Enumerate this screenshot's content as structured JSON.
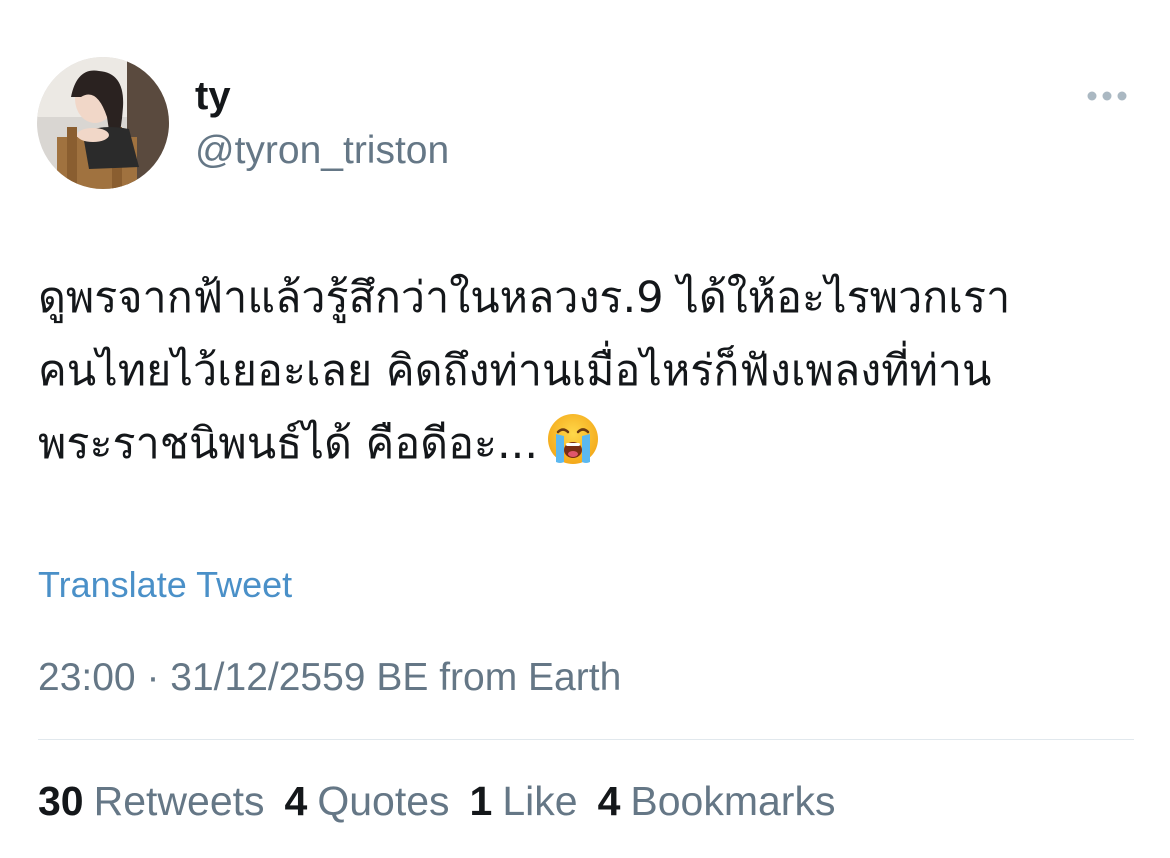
{
  "user": {
    "display_name": "ty",
    "handle": "@tyron_triston"
  },
  "menu": {
    "icon": "more-horizontal-icon"
  },
  "tweet": {
    "text_line1": "ดูพรจากฟ้าแล้วรู้สึกว่าในหลวงร.9 ได้ให้อะไรพวกเรา",
    "text_line2": "คนไทยไว้เยอะเลย คิดถึงท่านเมื่อไหร่ก็ฟังเพลงที่ท่าน",
    "text_line3": "พระราชนิพนธ์ได้ คือดีอะ...",
    "emoji": "loudly-crying-face-icon"
  },
  "translate_label": "Translate Tweet",
  "meta": {
    "time": "23:00",
    "separator": "·",
    "date": "31/12/2559 BE",
    "source": "from Earth"
  },
  "stats": {
    "retweets_count": "30",
    "retweets_label": "Retweets",
    "quotes_count": "4",
    "quotes_label": "Quotes",
    "likes_count": "1",
    "likes_label": "Like",
    "bookmarks_count": "4",
    "bookmarks_label": "Bookmarks"
  },
  "colors": {
    "text": "#14171a",
    "secondary": "#657786",
    "link": "#4a90c8",
    "divider": "#e1e8ed"
  }
}
